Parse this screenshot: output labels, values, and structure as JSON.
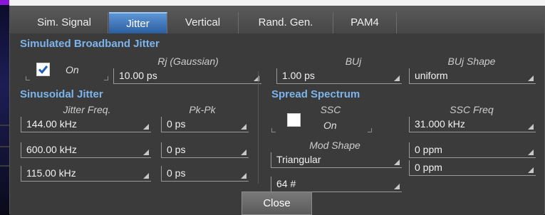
{
  "tabs": [
    "Sim. Signal",
    "Jitter",
    "Vertical",
    "Rand. Gen.",
    "PAM4"
  ],
  "active_tab": "Jitter",
  "broadband": {
    "title": "Simulated Broadband Jitter",
    "enable_label": "On",
    "enabled": true,
    "rj_label": "Rj (Gaussian)",
    "rj_value": "10.00 ps",
    "buj_label": "BUj",
    "buj_value": "1.00 ps",
    "buj_shape_label": "BUj Shape",
    "buj_shape_value": "uniform"
  },
  "sinusoidal": {
    "title": "Sinusoidal Jitter",
    "freq_label": "Jitter Freq.",
    "pkpk_label": "Pk-Pk",
    "rows": [
      {
        "freq": "144.00 kHz",
        "pkpk": "0 ps"
      },
      {
        "freq": "600.00 kHz",
        "pkpk": "0 ps"
      },
      {
        "freq": "115.00 kHz",
        "pkpk": "0 ps"
      }
    ]
  },
  "spread": {
    "title": "Spread Spectrum",
    "ssc_label": "SSC",
    "ssc_state": "On",
    "ssc_enabled": false,
    "freq_label": "SSC Freq",
    "freq_value": "31.000 kHz",
    "mod_label": "Mod Shape",
    "mod_value": "Triangular",
    "ppm_1": "0 ppm",
    "ppm_2": "0 ppm",
    "count_value": "64 #"
  },
  "close_label": "Close"
}
